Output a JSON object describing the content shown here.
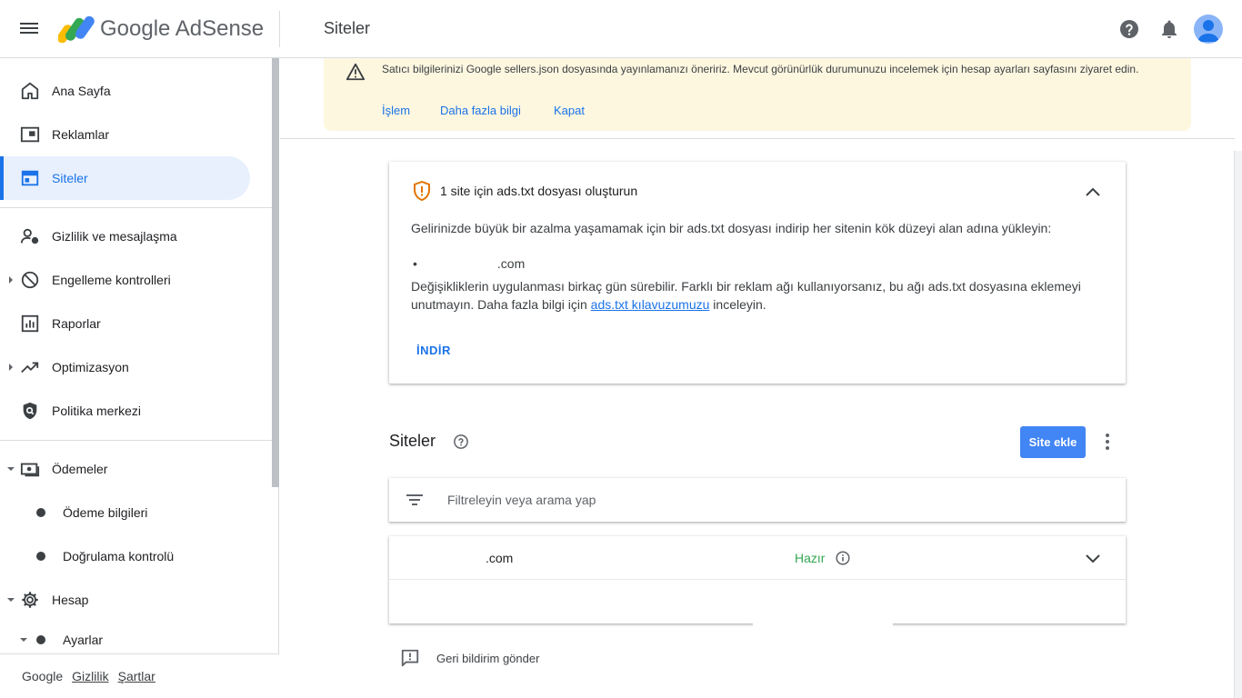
{
  "header": {
    "brand": "Google AdSense",
    "page_title": "Siteler"
  },
  "sidebar": {
    "items": [
      {
        "label": "Ana Sayfa"
      },
      {
        "label": "Reklamlar"
      },
      {
        "label": "Siteler"
      },
      {
        "label": "Gizlilik ve mesajlaşma"
      },
      {
        "label": "Engelleme kontrolleri"
      },
      {
        "label": "Raporlar"
      },
      {
        "label": "Optimizasyon"
      },
      {
        "label": "Politika merkezi"
      },
      {
        "label": "Ödemeler"
      },
      {
        "label": "Ödeme bilgileri"
      },
      {
        "label": "Doğrulama kontrolü"
      },
      {
        "label": "Hesap"
      },
      {
        "label": "Ayarlar"
      }
    ],
    "footer": {
      "google": "Google",
      "privacy": "Gizlilik",
      "terms": "Şartlar"
    }
  },
  "banner": {
    "text": "Satıcı bilgilerinizi Google sellers.json dosyasında yayınlamanızı öneririz. Mevcut görünürlük durumunuzu incelemek için hesap ayarları sayfasını ziyaret edin.",
    "action": "İşlem",
    "learn_more": "Daha fazla bilgi",
    "dismiss": "Kapat"
  },
  "ads_card": {
    "title": "1 site için ads.txt dosyası oluşturun",
    "intro": "Gelirinizde büyük bir azalma yaşamamak için bir ads.txt dosyası indirip her sitenin kök düzeyi alan adına yükleyin:",
    "site": ".com",
    "note_before": "Değişikliklerin uygulanması birkaç gün sürebilir. Farklı bir reklam ağı kullanıyorsanız, bu ağı ads.txt dosyasına eklemeyi unutmayın. Daha fazla bilgi için ",
    "note_link": "ads.txt kılavuzumuzu",
    "note_after": " inceleyin.",
    "download": "İNDİR"
  },
  "sites": {
    "heading": "Siteler",
    "add_button": "Site ekle",
    "filter_placeholder": "Filtreleyin veya arama yap",
    "rows": [
      {
        "name": ".com",
        "status": "Hazır"
      }
    ]
  },
  "feedback": {
    "label": "Geri bildirim gönder"
  },
  "colors": {
    "accent": "#1a73e8",
    "primary_button": "#4285f4",
    "banner_bg": "#fef7e0",
    "status_ready": "#34a853"
  }
}
